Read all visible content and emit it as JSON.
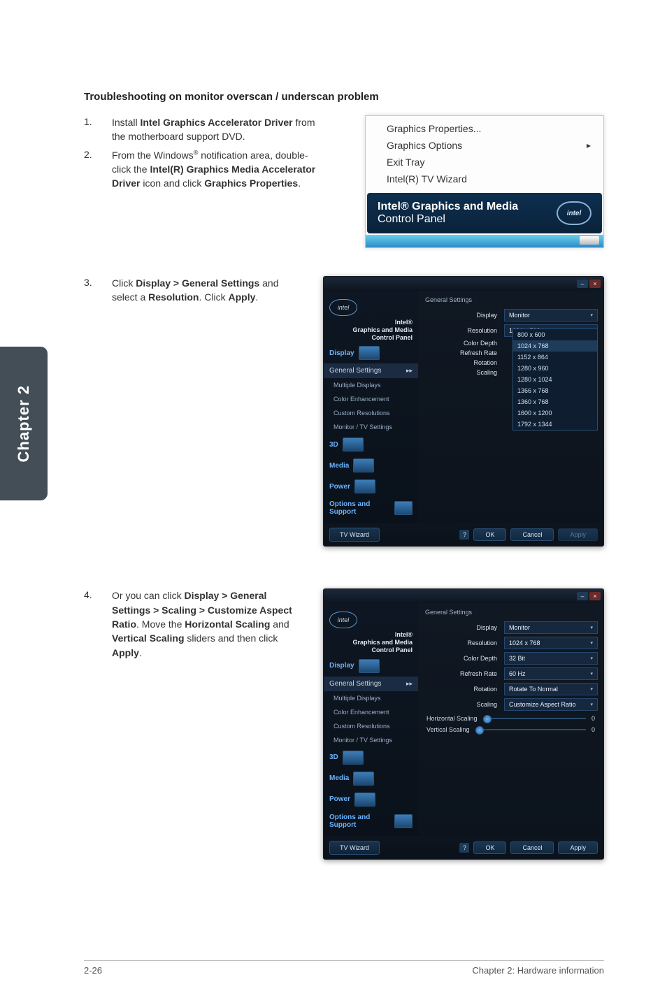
{
  "chapter_tab": "Chapter 2",
  "section_title": "Troubleshooting on monitor overscan / underscan problem",
  "steps": {
    "s1": {
      "num": "1.",
      "pre": "Install ",
      "bold": "Intel Graphics Accelerator Driver",
      "post": " from the motherboard support DVD."
    },
    "s2": {
      "num": "2.",
      "t1": "From the Windows",
      "sup": "®",
      "t2": " notification area, double-click the ",
      "b1": "Intel(R) Graphics Media Accelerator Driver",
      "t3": " icon and click ",
      "b2": "Graphics Properties",
      "t4": "."
    },
    "s3": {
      "num": "3.",
      "t1": "Click ",
      "b1": "Display > General Settings",
      "t2": " and select a ",
      "b2": "Resolution",
      "t3": ". Click ",
      "b3": "Apply",
      "t4": "."
    },
    "s4": {
      "num": "4.",
      "t1": "Or you can click ",
      "b1": "Display > General Settings > Scaling > Customize Aspect Ratio",
      "t2": ". Move the ",
      "b2": "Horizontal Scaling",
      "t3": " and ",
      "b3": "Vertical Scaling",
      "t4": " sliders and then click ",
      "b4": "Apply",
      "t5": "."
    }
  },
  "tray": {
    "items": {
      "a": "Graphics Properties...",
      "b": "Graphics Options",
      "c": "Exit Tray",
      "d": "Intel(R) TV Wizard"
    },
    "arrow": "▸",
    "balloon_title": "Intel® Graphics and Media",
    "balloon_sub": "Control Panel",
    "logo": "intel"
  },
  "cp": {
    "logo": "intel",
    "brand1": "Intel®",
    "brand2": "Graphics and Media",
    "brand3": "Control Panel",
    "sb": {
      "display": "Display",
      "gen": "General Settings",
      "multi": "Multiple Displays",
      "color": "Color Enhancement",
      "custom": "Custom Resolutions",
      "montv": "Monitor / TV Settings",
      "threeD": "3D",
      "media": "Media",
      "power": "Power",
      "options": "Options and Support"
    },
    "chev": "▸▸",
    "main_title": "General Settings",
    "labels": {
      "display": "Display",
      "monitor": "Monitor",
      "resolution": "Resolution",
      "colordepth": "Color Depth",
      "refresh": "Refresh Rate",
      "rotation": "Rotation",
      "scaling": "Scaling"
    },
    "caret": "▾",
    "values3": {
      "resolution": "1024 x 768"
    },
    "res_options": {
      "a": "800 x 600",
      "b": "1024 x 768",
      "c": "1152 x 864",
      "d": "1280 x 960",
      "e": "1280 x 1024",
      "f": "1366 x 768",
      "g": "1360 x 768",
      "h": "1600 x 1200",
      "i": "1792 x 1344"
    },
    "values4": {
      "resolution": "1024 x 768",
      "colordepth": "32 Bit",
      "refresh": "60 Hz",
      "rotation": "Rotate To Normal",
      "scaling": "Customize Aspect Ratio"
    },
    "sliders": {
      "h": "Horizontal Scaling",
      "v": "Vertical Scaling",
      "zero": "0"
    },
    "bottom": {
      "tv": "TV Wizard",
      "help": "?",
      "ok": "OK",
      "cancel": "Cancel",
      "apply": "Apply"
    },
    "winmin": "–",
    "winclose": "×"
  },
  "footer": {
    "left": "2-26",
    "right": "Chapter 2: Hardware information"
  }
}
